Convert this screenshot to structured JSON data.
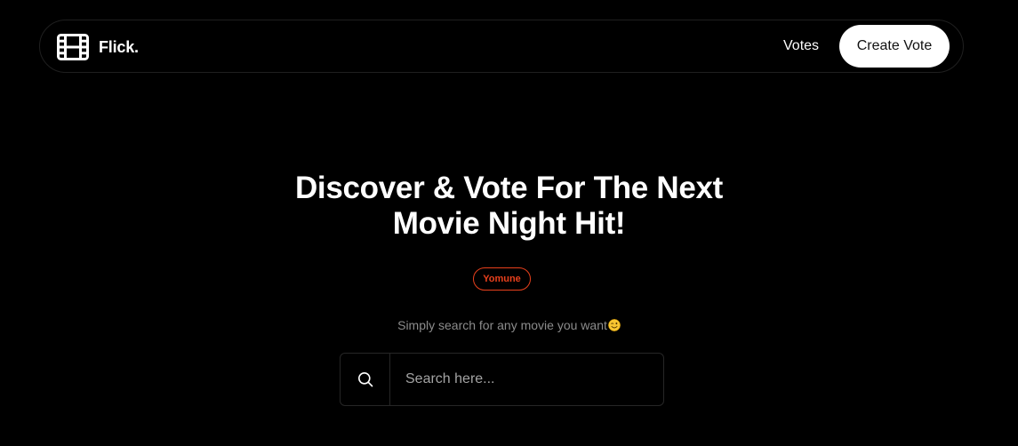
{
  "navbar": {
    "brand_name": "Flick.",
    "brand_icon": "film-icon",
    "votes_link": "Votes",
    "create_vote_button": "Create Vote"
  },
  "hero": {
    "title_line1": "Discover & Vote For The Next",
    "title_line2": "Movie Night Hit!",
    "tag": "Yomune",
    "subtitle": "Simply search for any movie you want",
    "subtitle_emoji": "winking-face-emoji"
  },
  "search": {
    "icon": "search-icon",
    "placeholder": "Search here...",
    "value": ""
  },
  "colors": {
    "background": "#000000",
    "text": "#ffffff",
    "accent": "#e8401c",
    "muted": "#8c8c8c",
    "border": "#262626"
  }
}
